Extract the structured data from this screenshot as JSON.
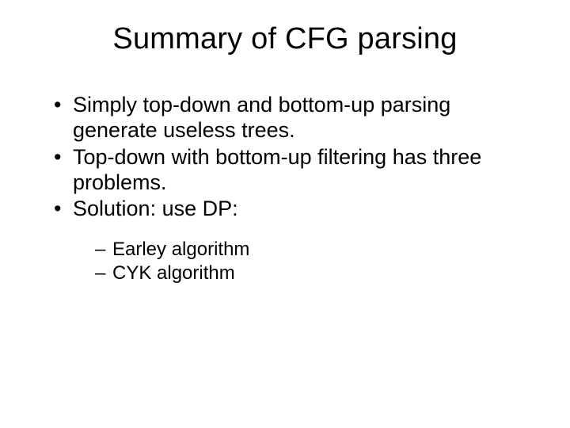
{
  "title": "Summary of CFG parsing",
  "bullets": [
    "Simply top-down and bottom-up parsing generate useless trees.",
    "Top-down with bottom-up filtering has three problems.",
    "Solution: use DP:"
  ],
  "subbullets": [
    "Earley algorithm",
    "CYK algorithm"
  ]
}
